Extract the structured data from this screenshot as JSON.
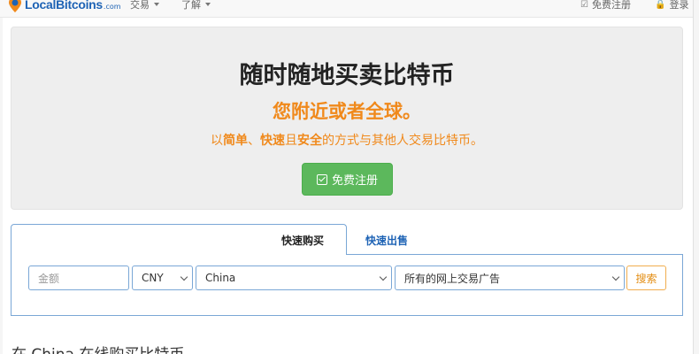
{
  "navbar": {
    "brand": "LocalBitcoins",
    "brand_suffix": ".com",
    "menu_trade": "交易",
    "menu_learn": "了解",
    "signup_link": "免费注册",
    "login_link": "登录"
  },
  "hero": {
    "title": "随时随地买卖比特币",
    "subtitle": "您附近或者全球。",
    "desc_1": "以",
    "desc_2": "简单",
    "desc_3": "、",
    "desc_4": "快速",
    "desc_5": "且",
    "desc_6": "安全",
    "desc_7": "的方式与其他人交易比特币。",
    "signup_button": "免费注册"
  },
  "quick_trade": {
    "tab_buy": "快速购买",
    "tab_sell": "快速出售",
    "amount_placeholder": "金额",
    "currency": "CNY",
    "country": "China",
    "payment_method": "所有的网上交易广告",
    "search_button": "搜索"
  },
  "section_title": "在 China 在线购买比特币",
  "colors": {
    "accent_orange": "#f0891b",
    "brand_blue": "#1e63b5",
    "success_green": "#5cb85c"
  }
}
